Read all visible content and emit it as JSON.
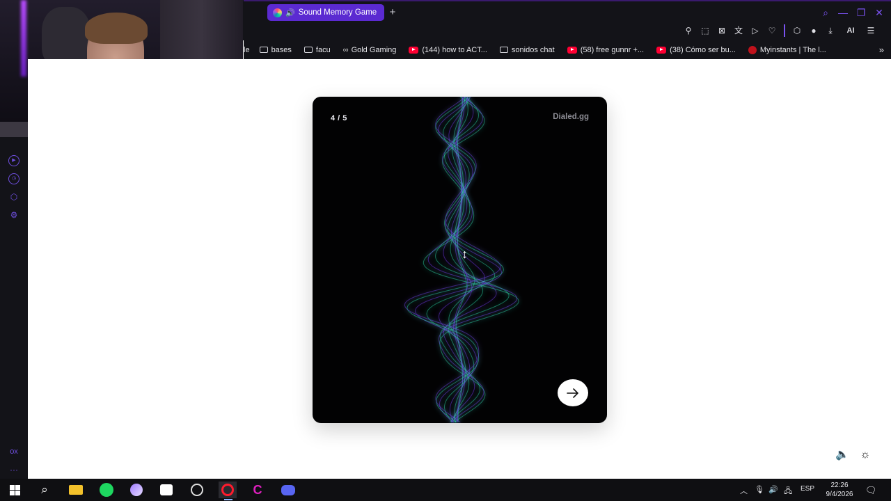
{
  "browser": {
    "active_tab": {
      "title": "Sound Memory Game"
    },
    "new_tab_label": "+",
    "toolbar": {
      "ai_label": "AI"
    },
    "bookmarks": [
      {
        "icon": "partial-label",
        "label": "le"
      },
      {
        "icon": "folder-icon",
        "label": "bases"
      },
      {
        "icon": "folder-icon",
        "label": "facu"
      },
      {
        "icon": "gaming-icon",
        "label": "Gold Gaming"
      },
      {
        "icon": "youtube-icon",
        "label": "(144) how to ACT..."
      },
      {
        "icon": "folder-icon",
        "label": "sonidos chat"
      },
      {
        "icon": "youtube-icon",
        "label": "(58) free gunnr +..."
      },
      {
        "icon": "youtube-icon",
        "label": "(38) Cómo ser bu..."
      },
      {
        "icon": "myinstants-icon",
        "label": "Myinstants | The l..."
      }
    ],
    "sidebar_bottom_label": "ox",
    "accent": "#5b2ad1"
  },
  "game": {
    "progress": "4 / 5",
    "brand": "Dialed.gg",
    "wave_colors": {
      "teal": "#2ee6b4",
      "purple": "#7b3bff"
    }
  },
  "taskbar": {
    "lang": "ESP",
    "time": "22:26",
    "date": "9/4/2026",
    "notifications_count": "1"
  }
}
